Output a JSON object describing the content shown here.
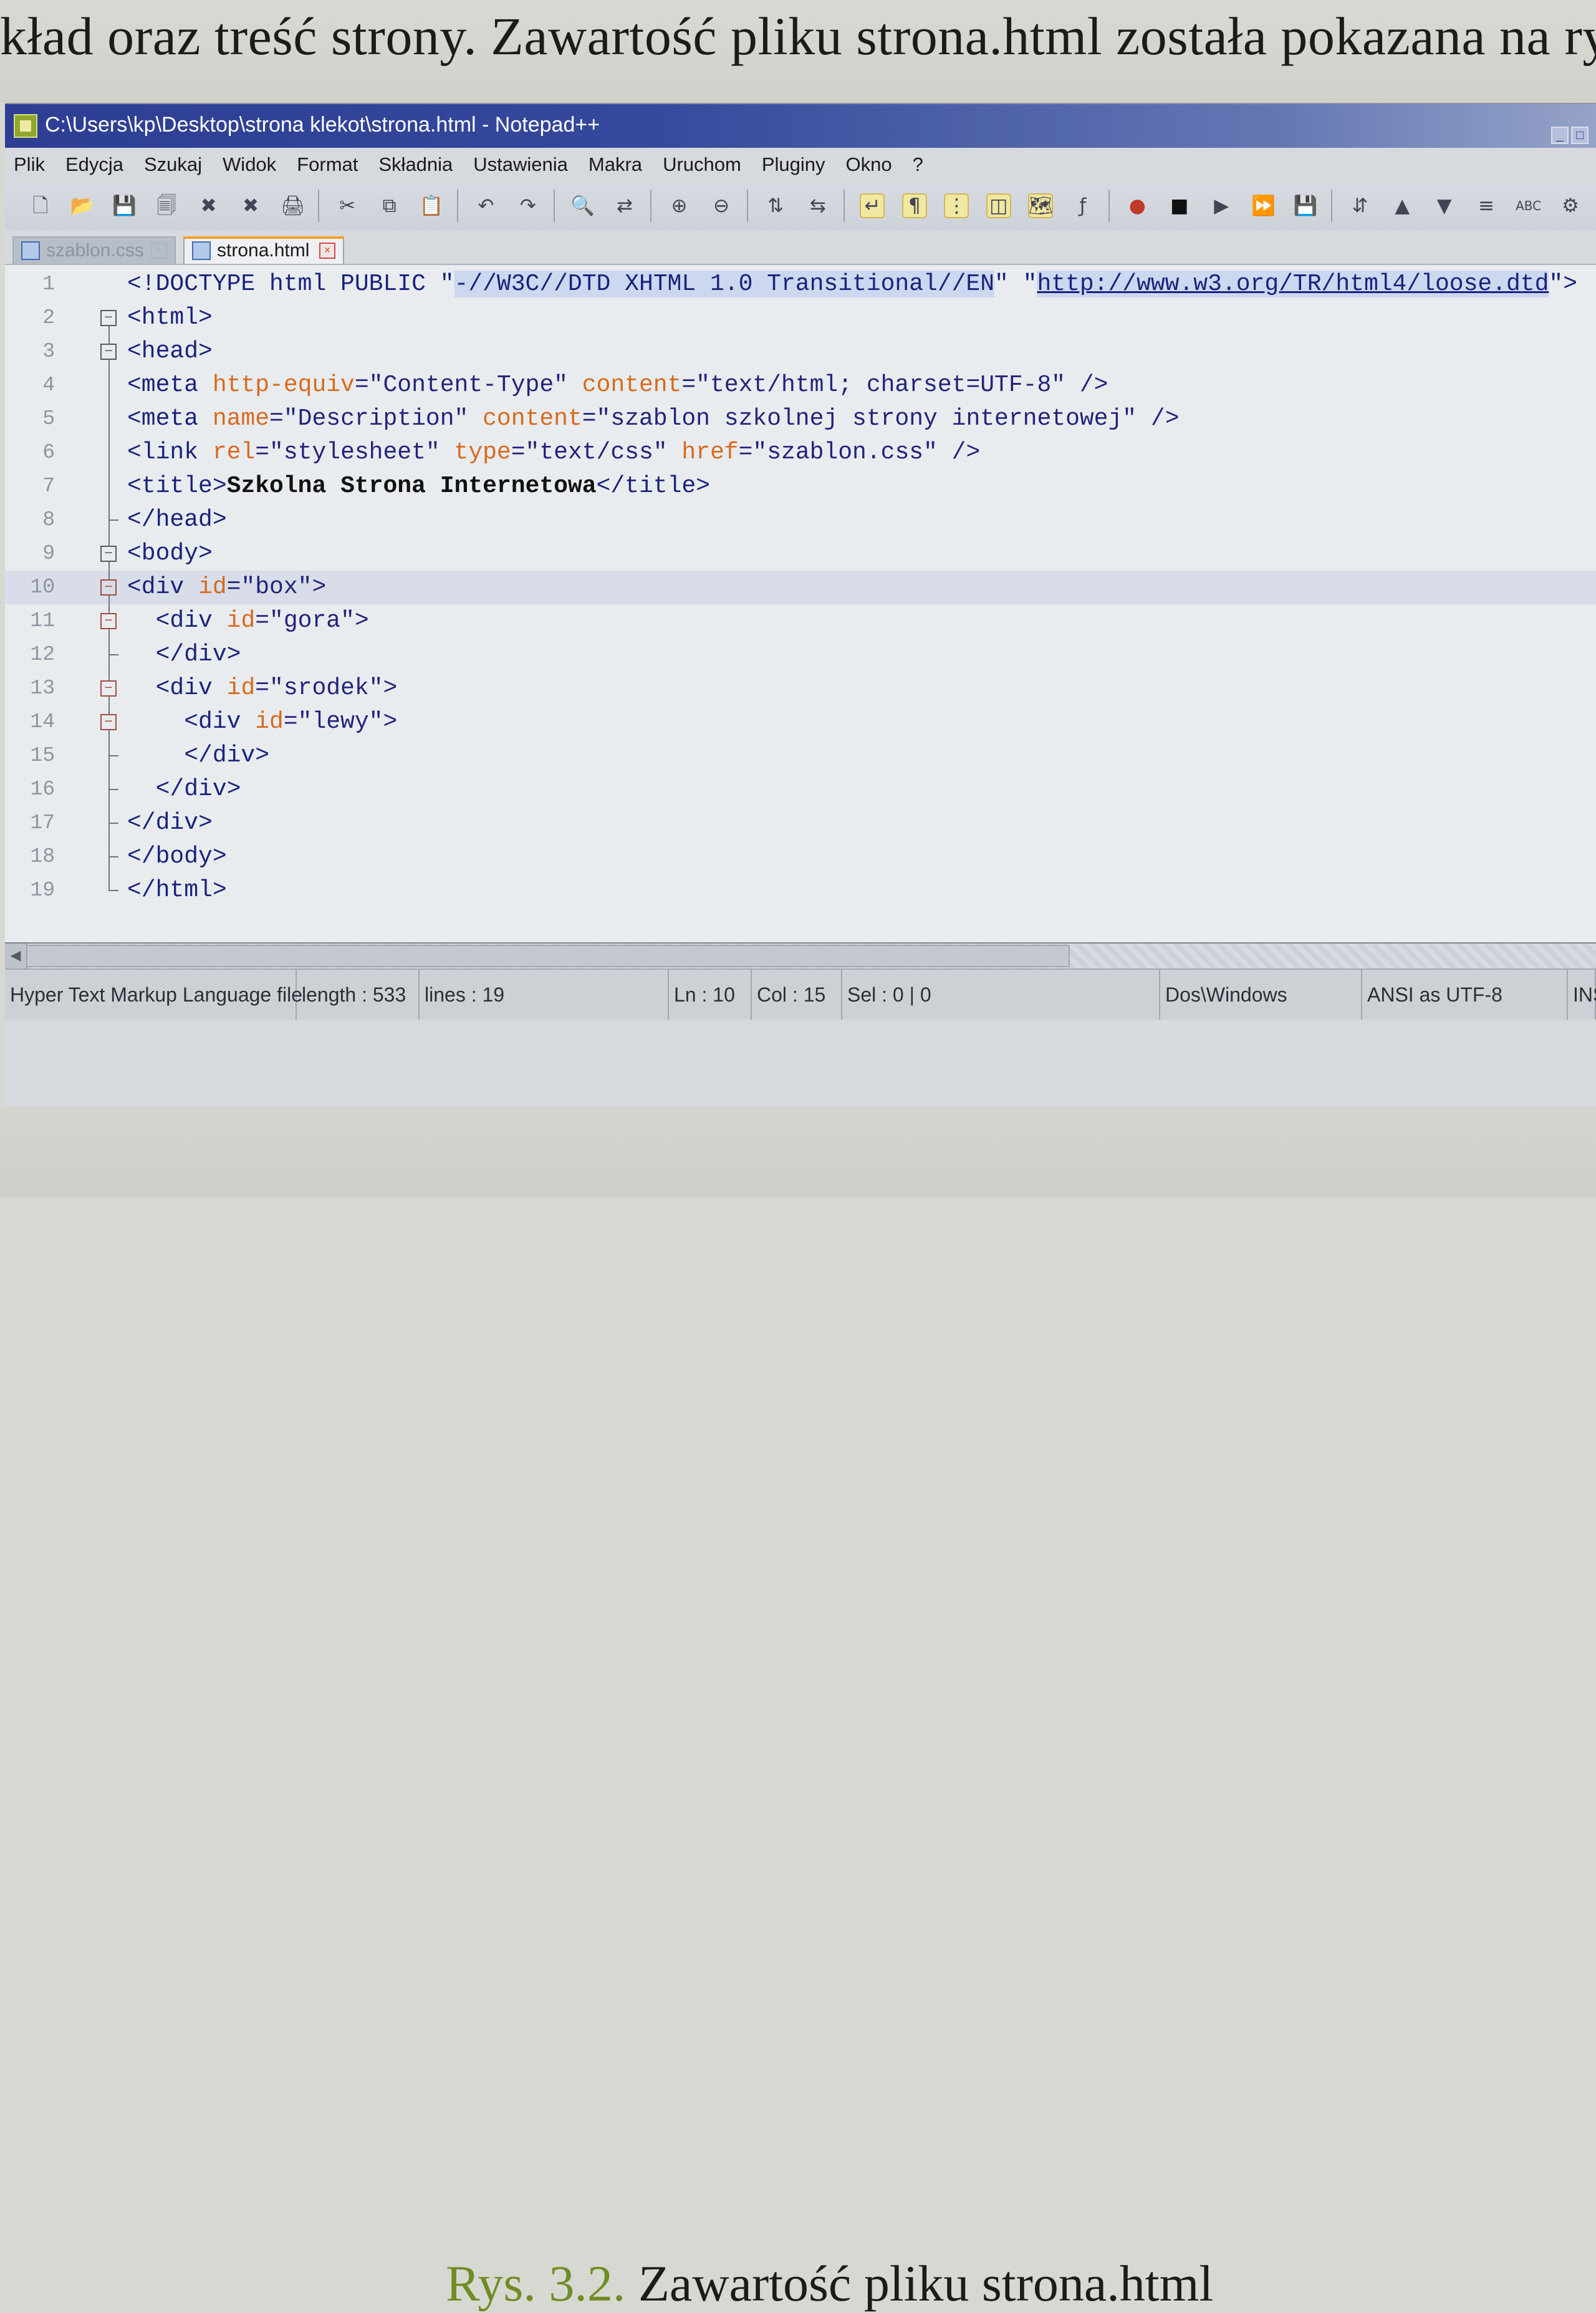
{
  "book": {
    "top_text": "kład oraz treść strony. Zawartość pliku strona.html została pokazana na rys",
    "caption_label": "Rys. 3.2.",
    "caption_text": " Zawartość pliku strona.html"
  },
  "window": {
    "title": "C:\\Users\\kp\\Desktop\\strona klekot\\strona.html - Notepad++",
    "minimize_symbol": "_",
    "maximize_symbol": "□"
  },
  "menu": {
    "items": [
      "Plik",
      "Edycja",
      "Szukaj",
      "Widok",
      "Format",
      "Składnia",
      "Ustawienia",
      "Makra",
      "Uruchom",
      "Pluginy",
      "Okno",
      "?"
    ]
  },
  "toolbar": {
    "icons": [
      "new-file-icon",
      "open-file-icon",
      "save-icon",
      "save-all-icon",
      "close-icon",
      "close-all-icon",
      "print-icon",
      "cut-icon",
      "copy-icon",
      "paste-icon",
      "undo-icon",
      "redo-icon",
      "find-icon",
      "replace-icon",
      "zoom-in-icon",
      "zoom-out-icon",
      "sync-vertical-icon",
      "sync-horizontal-icon",
      "wrap-icon",
      "all-chars-icon",
      "indent-guide-icon",
      "user-defined-icon",
      "doc-map-icon",
      "function-list-icon",
      "record-icon",
      "stop-icon",
      "play-icon",
      "playback-icon",
      "save-macro-icon",
      "sort-icon",
      "up-icon",
      "down-icon",
      "trim-icon",
      "spell-icon",
      "plugin-icon"
    ],
    "glyphs": [
      "🗋",
      "📂",
      "💾",
      "🗐",
      "✖",
      "✖",
      "🖨",
      "✂",
      "⧉",
      "📋",
      "↶",
      "↷",
      "🔍",
      "⇄",
      "⊕",
      "⊖",
      "⇅",
      "⇆",
      "↵",
      "¶",
      "⋮",
      "◫",
      "🗺",
      "ƒ",
      "●",
      "■",
      "▶",
      "⏩",
      "💾",
      "⇵",
      "▲",
      "▼",
      "≡",
      "ABC",
      "⚙"
    ]
  },
  "tabs": [
    {
      "label": "szablon.css",
      "active": false
    },
    {
      "label": "strona.html",
      "active": true
    }
  ],
  "editor": {
    "lines": [
      {
        "number": "1",
        "current": false,
        "fold": "",
        "content": [
          {
            "text": "<!DOCTYPE html PUBLIC \"",
            "class": "tag"
          },
          {
            "text": "-//W3C//DTD XHTML 1.0 Transitional//EN",
            "class": "tag selected"
          },
          {
            "text": "\" \"",
            "class": "tag"
          },
          {
            "text": "http://www.w3.org/TR/html4/loose.dtd",
            "class": "tag selected url"
          },
          {
            "text": "\">",
            "class": "tag"
          }
        ]
      },
      {
        "number": "2",
        "current": false,
        "fold": "box",
        "content": [
          {
            "text": "<html>",
            "class": "tag"
          }
        ]
      },
      {
        "number": "3",
        "current": false,
        "fold": "box",
        "content": [
          {
            "text": "<head>",
            "class": "tag"
          }
        ]
      },
      {
        "number": "4",
        "current": false,
        "fold": "line",
        "content": [
          {
            "text": "<meta ",
            "class": "tag"
          },
          {
            "text": "http-equiv",
            "class": "attr"
          },
          {
            "text": "=\"Content-Type\" ",
            "class": "str"
          },
          {
            "text": "content",
            "class": "attr"
          },
          {
            "text": "=\"text/html; charset=UTF-8\" />",
            "class": "str"
          }
        ]
      },
      {
        "number": "5",
        "current": false,
        "fold": "line",
        "content": [
          {
            "text": "<meta ",
            "class": "tag"
          },
          {
            "text": "name",
            "class": "attr"
          },
          {
            "text": "=\"Description\" ",
            "class": "str"
          },
          {
            "text": "content",
            "class": "attr"
          },
          {
            "text": "=\"szablon szkolnej strony internetowej\" />",
            "class": "str"
          }
        ]
      },
      {
        "number": "6",
        "current": false,
        "fold": "line",
        "content": [
          {
            "text": "<link ",
            "class": "tag"
          },
          {
            "text": "rel",
            "class": "attr"
          },
          {
            "text": "=\"stylesheet\" ",
            "class": "str"
          },
          {
            "text": "type",
            "class": "attr"
          },
          {
            "text": "=\"text/css\" ",
            "class": "str"
          },
          {
            "text": "href",
            "class": "attr"
          },
          {
            "text": "=\"szablon.css\" />",
            "class": "str"
          }
        ]
      },
      {
        "number": "7",
        "current": false,
        "fold": "line",
        "content": [
          {
            "text": "<title>",
            "class": "tag"
          },
          {
            "text": "Szkolna Strona Internetowa",
            "class": "black"
          },
          {
            "text": "</title>",
            "class": "tag"
          }
        ]
      },
      {
        "number": "8",
        "current": false,
        "fold": "end",
        "content": [
          {
            "text": "</head>",
            "class": "tag"
          }
        ]
      },
      {
        "number": "9",
        "current": false,
        "fold": "box",
        "content": [
          {
            "text": "<body>",
            "class": "tag"
          }
        ]
      },
      {
        "number": "10",
        "current": true,
        "fold": "box-red",
        "content": [
          {
            "text": "<div ",
            "class": "tag"
          },
          {
            "text": "id",
            "class": "attr"
          },
          {
            "text": "=\"box\">",
            "class": "str"
          }
        ]
      },
      {
        "number": "11",
        "current": false,
        "fold": "box-red",
        "content": [
          {
            "text": "  <div ",
            "class": "tag"
          },
          {
            "text": "id",
            "class": "attr"
          },
          {
            "text": "=\"gora\">",
            "class": "str"
          }
        ]
      },
      {
        "number": "12",
        "current": false,
        "fold": "end",
        "content": [
          {
            "text": "  </div>",
            "class": "tag"
          }
        ]
      },
      {
        "number": "13",
        "current": false,
        "fold": "box-red",
        "content": [
          {
            "text": "  <div ",
            "class": "tag"
          },
          {
            "text": "id",
            "class": "attr"
          },
          {
            "text": "=\"srodek\">",
            "class": "str"
          }
        ]
      },
      {
        "number": "14",
        "current": false,
        "fold": "box-red",
        "content": [
          {
            "text": "    <div ",
            "class": "tag"
          },
          {
            "text": "id",
            "class": "attr"
          },
          {
            "text": "=\"lewy\">",
            "class": "str"
          }
        ]
      },
      {
        "number": "15",
        "current": false,
        "fold": "end",
        "content": [
          {
            "text": "    </div>",
            "class": "tag"
          }
        ]
      },
      {
        "number": "16",
        "current": false,
        "fold": "end",
        "content": [
          {
            "text": "  </div>",
            "class": "tag"
          }
        ]
      },
      {
        "number": "17",
        "current": false,
        "fold": "end",
        "content": [
          {
            "text": "</div>",
            "class": "tag"
          }
        ]
      },
      {
        "number": "18",
        "current": false,
        "fold": "end",
        "content": [
          {
            "text": "</body>",
            "class": "tag"
          }
        ]
      },
      {
        "number": "19",
        "current": false,
        "fold": "end-last",
        "content": [
          {
            "text": "</html>",
            "class": "tag"
          }
        ]
      }
    ]
  },
  "status": {
    "file_type": "Hyper Text Markup Language file",
    "length": "length : 533",
    "lines": "lines : 19",
    "ln": "Ln : 10",
    "col": "Col : 15",
    "sel": "Sel : 0 | 0",
    "eol": "Dos\\Windows",
    "encoding": "ANSI as UTF-8",
    "mode": "INS"
  },
  "colors": {
    "title_bar": "#2d3e94",
    "tab_highlight": "#f0a226",
    "caption_label": "#6f8d26",
    "tag": "#19237b",
    "attribute": "#d86a1d",
    "selection": "#cbd8ef"
  }
}
